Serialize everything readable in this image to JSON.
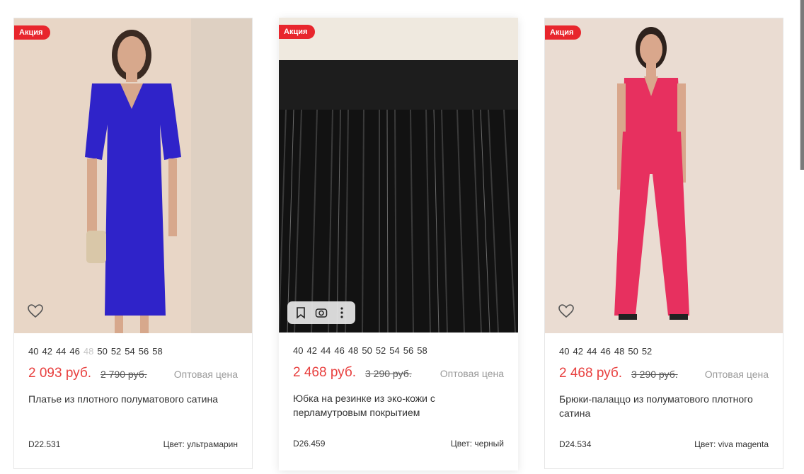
{
  "cards": [
    {
      "badge": "Акция",
      "sizes": [
        {
          "label": "40"
        },
        {
          "label": "42"
        },
        {
          "label": "44"
        },
        {
          "label": "46"
        },
        {
          "label": "48",
          "unavailable": true
        },
        {
          "label": "50"
        },
        {
          "label": "52"
        },
        {
          "label": "54"
        },
        {
          "label": "56"
        },
        {
          "label": "58"
        }
      ],
      "price": "2 093 руб.",
      "old_price": "2 790 руб.",
      "wholesale_label": "Оптовая цена",
      "name": "Платье из плотного полуматового сатина",
      "sku": "D22.531",
      "color": "Цвет: ультрамарин",
      "product_color_hex": "#2f23c9",
      "background_hex": "#e6d3c2",
      "icons": [
        "heart-icon"
      ]
    },
    {
      "badge": "Акция",
      "sizes": [
        {
          "label": "40"
        },
        {
          "label": "42"
        },
        {
          "label": "44"
        },
        {
          "label": "46"
        },
        {
          "label": "48"
        },
        {
          "label": "50"
        },
        {
          "label": "52"
        },
        {
          "label": "54"
        },
        {
          "label": "56"
        },
        {
          "label": "58"
        }
      ],
      "price": "2 468 руб.",
      "old_price": "3 290 руб.",
      "wholesale_label": "Оптовая цена",
      "name": "Юбка на резинке из эко-кожи с перламутровым покрытием",
      "sku": "D26.459",
      "color": "Цвет: черный",
      "product_color_hex": "#1a1a1a",
      "background_hex": "#f0ece3",
      "icons": [
        "bookmark-icon",
        "camera-icon",
        "more-icon"
      ]
    },
    {
      "badge": "Акция",
      "sizes": [
        {
          "label": "40"
        },
        {
          "label": "42"
        },
        {
          "label": "44"
        },
        {
          "label": "46"
        },
        {
          "label": "48"
        },
        {
          "label": "50"
        },
        {
          "label": "52"
        }
      ],
      "price": "2 468 руб.",
      "old_price": "3 290 руб.",
      "wholesale_label": "Оптовая цена",
      "name": "Брюки-палаццо из полуматового плотного сатина",
      "sku": "D24.534",
      "color": "Цвет: viva magenta",
      "product_color_hex": "#e7305f",
      "background_hex": "#e8dbd1",
      "icons": [
        "heart-icon"
      ]
    }
  ],
  "colors": {
    "sale_badge": "#e8262d",
    "price": "#e8403f"
  }
}
